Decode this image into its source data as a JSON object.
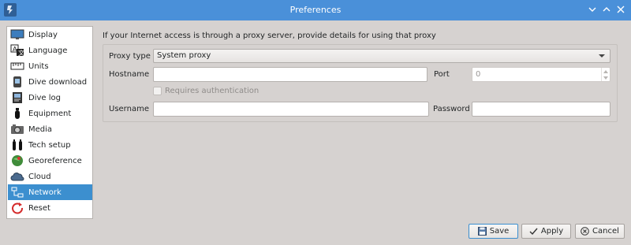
{
  "window": {
    "title": "Preferences",
    "controls": [
      "minimize-icon",
      "maximize-icon",
      "close-icon"
    ]
  },
  "sidebar": {
    "selected_index": 10,
    "items": [
      {
        "label": "Display",
        "icon": "display-icon"
      },
      {
        "label": "Language",
        "icon": "language-icon"
      },
      {
        "label": "Units",
        "icon": "units-icon"
      },
      {
        "label": "Dive download",
        "icon": "dive-download-icon"
      },
      {
        "label": "Dive log",
        "icon": "dive-log-icon"
      },
      {
        "label": "Equipment",
        "icon": "equipment-icon"
      },
      {
        "label": "Media",
        "icon": "media-icon"
      },
      {
        "label": "Tech setup",
        "icon": "tech-setup-icon"
      },
      {
        "label": "Georeference",
        "icon": "georeference-icon"
      },
      {
        "label": "Cloud",
        "icon": "cloud-icon"
      },
      {
        "label": "Network",
        "icon": "network-icon"
      },
      {
        "label": "Reset",
        "icon": "reset-icon"
      }
    ]
  },
  "network": {
    "intro": "If your Internet access is through a proxy server, provide details for using that proxy",
    "proxy_type_label": "Proxy type",
    "proxy_type_value": "System proxy",
    "hostname_label": "Hostname",
    "hostname_value": "",
    "port_label": "Port",
    "port_value": "0",
    "auth_label": "Requires authentication",
    "auth_checked": false,
    "username_label": "Username",
    "username_value": "",
    "password_label": "Password",
    "password_value": ""
  },
  "buttons": {
    "save": "Save",
    "apply": "Apply",
    "cancel": "Cancel"
  },
  "colors": {
    "titlebar": "#4a90d9",
    "selection": "#3c8fcf",
    "window_bg": "#d6d2d0"
  }
}
